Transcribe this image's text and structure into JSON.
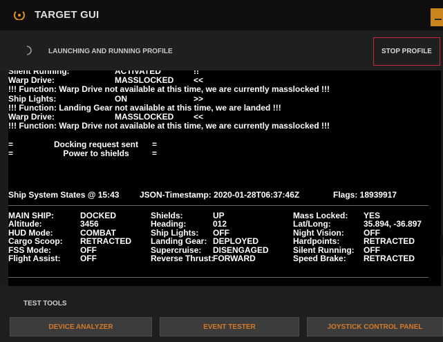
{
  "window": {
    "title": "TARGET GUI"
  },
  "profile": {
    "status": "LAUNCHING AND RUNNING PROFILE",
    "stop_label": "STOP PROFILE"
  },
  "log": [
    [
      "Silent Running:",
      "ACTIVATED",
      "!!"
    ],
    [
      "Warp Drive:",
      "MASSLOCKED",
      "<<"
    ],
    [
      "!!! Function: Warp Drive not available at this time, we are currently masslocked !!!",
      "",
      ""
    ],
    [
      "Ship Lights:",
      "ON",
      ">>"
    ],
    [
      "!!! Function: Landing Gear not available at this time, we are landed !!!",
      "",
      ""
    ],
    [
      "Warp Drive:",
      "MASSLOCKED",
      "<<"
    ],
    [
      "!!! Function: Warp Drive not available at this time, we are currently masslocked !!!",
      "",
      ""
    ],
    [
      "",
      "",
      ""
    ],
    [
      "=",
      "Docking request sent",
      "="
    ],
    [
      "=",
      "Power to shields",
      "="
    ]
  ],
  "state_header": {
    "title": "Ship System States @ 15:43",
    "timestamp": "JSON-Timestamp: 2020-01-28T06:37:46Z",
    "flags": "Flags: 18939917"
  },
  "states": [
    [
      "MAIN SHIP:",
      "DOCKED",
      "Shields:",
      "UP",
      "Mass Locked:",
      "YES"
    ],
    [
      "Altitude:",
      "3456",
      "Heading:",
      "012",
      "Lat/Long:",
      "35.894, -36.897"
    ],
    [
      "HUD Mode:",
      "COMBAT",
      "Ship Lights:",
      "OFF",
      "Night Vision:",
      "OFF"
    ],
    [
      "Cargo Scoop:",
      "RETRACTED",
      "Landing Gear:",
      "DEPLOYED",
      "Hardpoints:",
      "RETRACTED"
    ],
    [
      "FSS Mode:",
      "OFF",
      "Supercruise:",
      "DISENGAGED",
      "Silent Running:",
      "OFF"
    ],
    [
      "Flight Assist:",
      "OFF",
      "Reverse Thrust:",
      "FORWARD",
      "Speed Brake:",
      "RETRACTED"
    ]
  ],
  "tools": {
    "label": "TEST TOOLS",
    "buttons": [
      "DEVICE ANALYZER",
      "EVENT TESTER",
      "JOYSTICK CONTROL PANEL"
    ]
  },
  "colors": {
    "accent": "#c8861d",
    "stop_border": "#c8283a",
    "tool_text": "#d67a2a"
  }
}
